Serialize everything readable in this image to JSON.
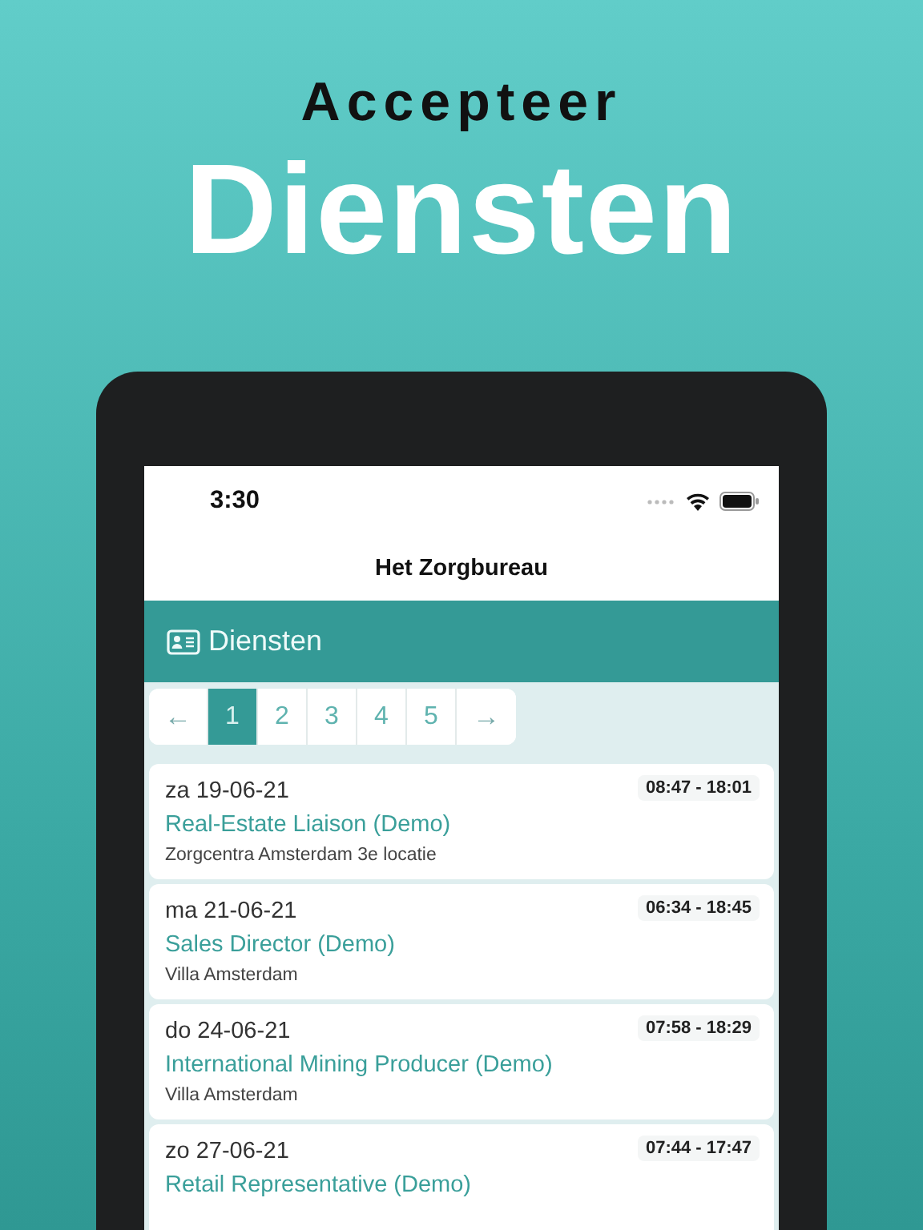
{
  "headline": {
    "line_1": "Accepteer",
    "line_2": "Diensten"
  },
  "status_bar": {
    "time": "3:30"
  },
  "app": {
    "title": "Het Zorgbureau"
  },
  "section": {
    "title": "Diensten"
  },
  "pagination": {
    "previous": "←",
    "next": "→",
    "pages": [
      {
        "label": "1",
        "selected": true
      },
      {
        "label": "2",
        "selected": false
      },
      {
        "label": "3",
        "selected": false
      },
      {
        "label": "4",
        "selected": false
      },
      {
        "label": "5",
        "selected": false
      }
    ]
  },
  "shifts": [
    {
      "date": "za 19-06-21",
      "time": "08:47 - 18:01",
      "role": "Real-Estate Liaison (Demo)",
      "location": "Zorgcentra Amsterdam 3e locatie"
    },
    {
      "date": "ma 21-06-21",
      "time": "06:34 - 18:45",
      "role": "Sales Director (Demo)",
      "location": "Villa Amsterdam"
    },
    {
      "date": "do 24-06-21",
      "time": "07:58 - 18:29",
      "role": "International Mining Producer (Demo)",
      "location": "Villa Amsterdam"
    },
    {
      "date": "zo 27-06-21",
      "time": "07:44 - 17:47",
      "role": "Retail Representative (Demo)"
    }
  ]
}
